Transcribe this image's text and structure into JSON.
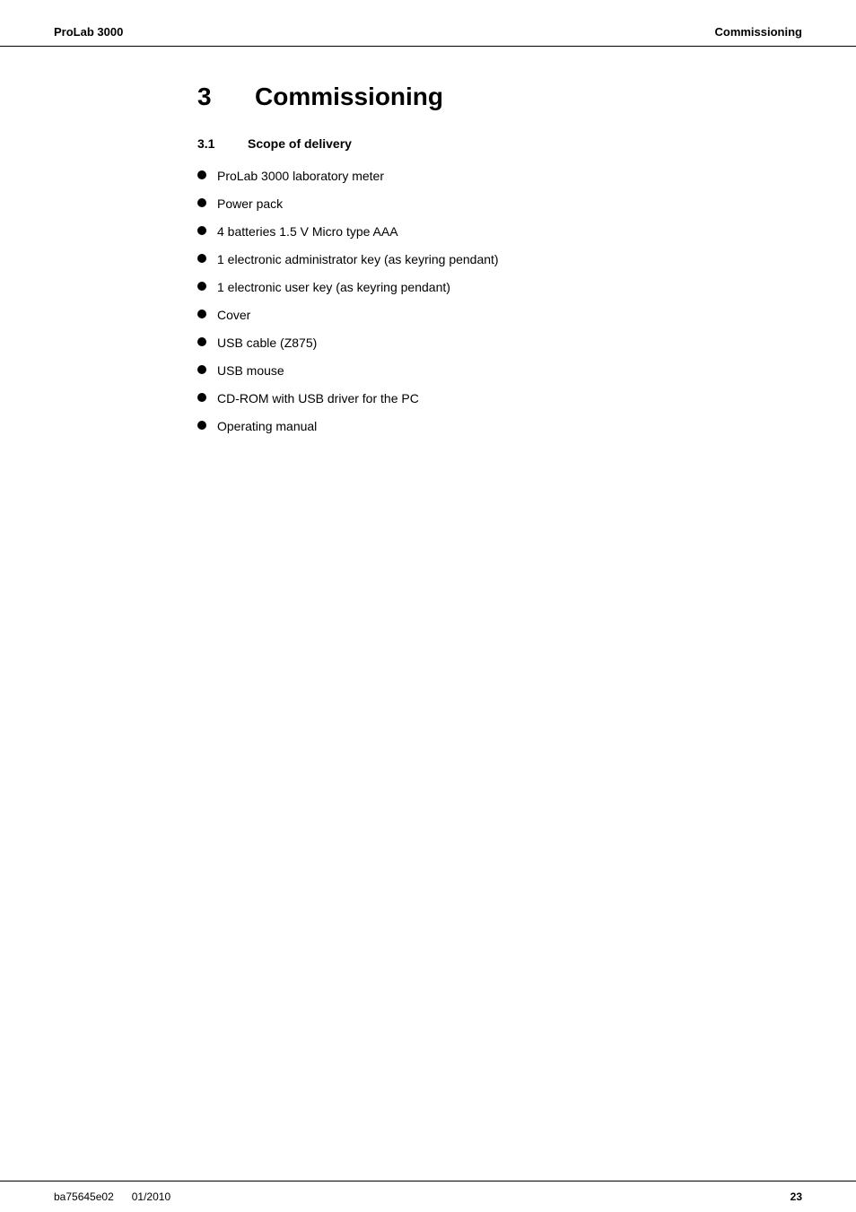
{
  "header": {
    "left": "ProLab 3000",
    "right": "Commissioning"
  },
  "chapter": {
    "number": "3",
    "title": "Commissioning"
  },
  "section": {
    "number": "3.1",
    "title": "Scope of delivery"
  },
  "bullet_items": [
    "ProLab 3000 laboratory meter",
    "Power pack",
    "4 batteries 1.5 V Micro type AAA",
    "1 electronic administrator key (as keyring pendant)",
    "1 electronic user key (as keyring pendant)",
    "Cover",
    "USB cable (Z875)",
    "USB mouse",
    "CD-ROM with USB driver for the PC",
    "Operating manual"
  ],
  "footer": {
    "doc_number": "ba75645e02",
    "date": "01/2010",
    "page": "23"
  }
}
